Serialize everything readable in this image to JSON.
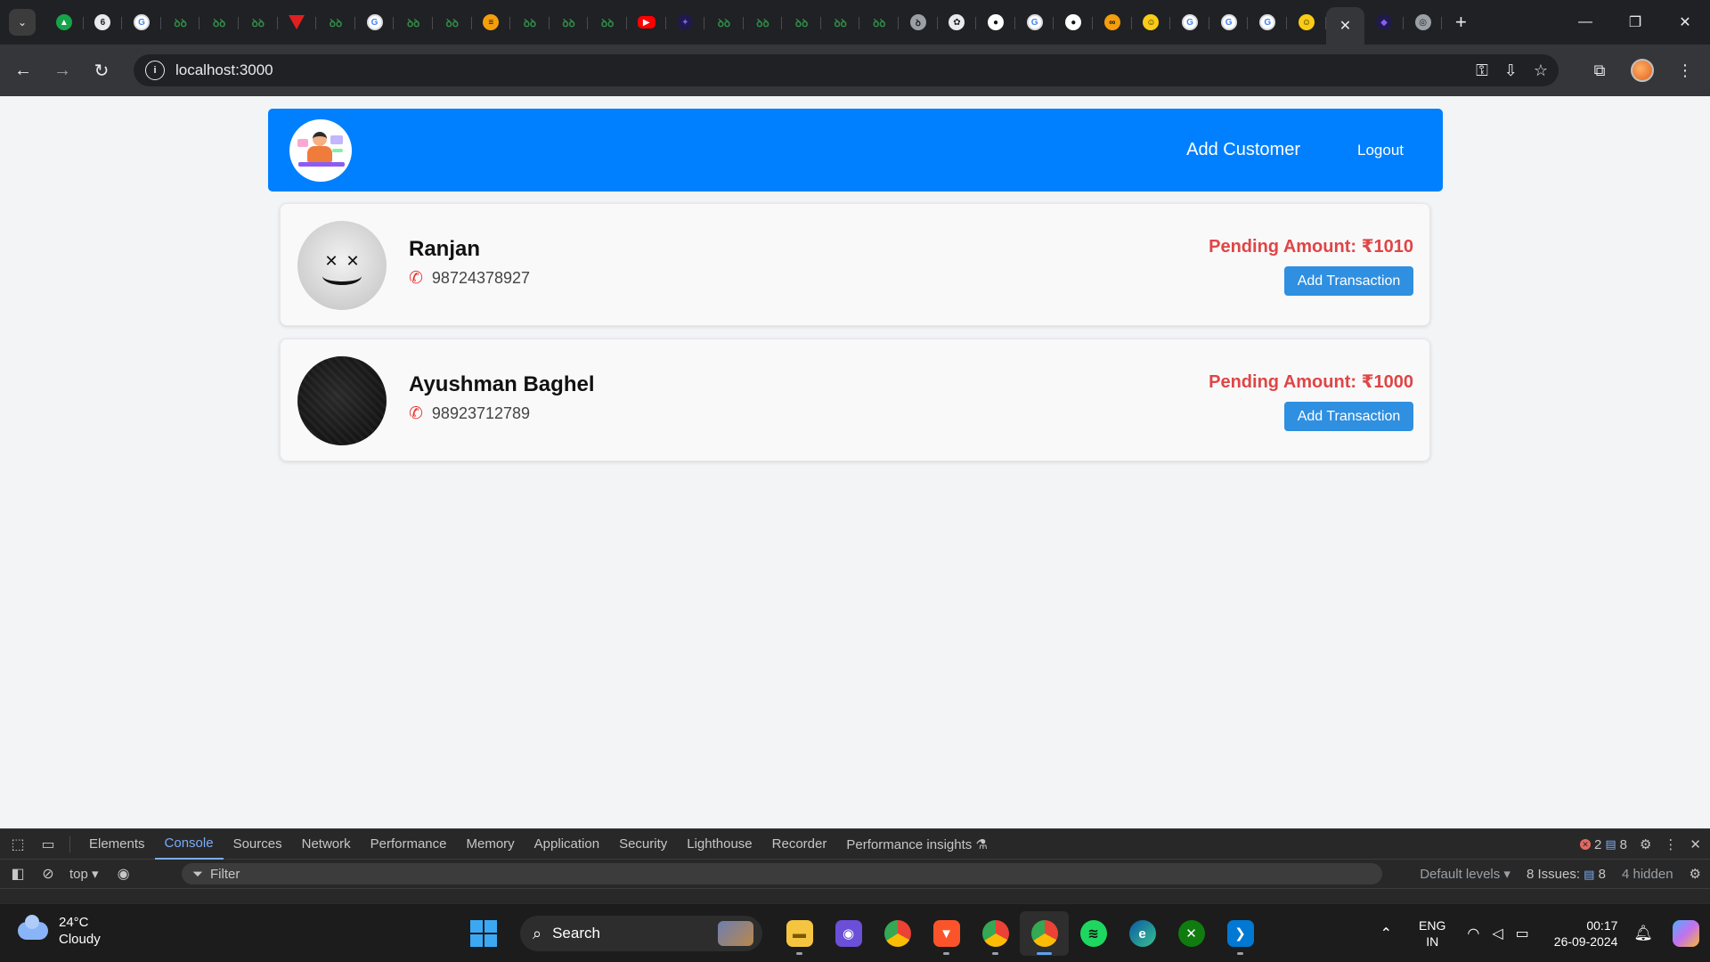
{
  "browser": {
    "tab_favicons": [
      "gfg-icon-green-circle",
      "chromatic-icon",
      "google-icon",
      "gfg-icon",
      "gfg-icon",
      "gfg-icon",
      "vercel-icon",
      "gfg-icon",
      "google-icon",
      "gfg-icon",
      "gfg-icon",
      "sort-icon",
      "gfg-icon",
      "gfg-icon",
      "gfg-icon",
      "youtube-icon",
      "dark-app-icon",
      "gfg-icon",
      "gfg-icon",
      "gfg-icon",
      "gfg-icon",
      "gfg-icon",
      "gfg-icon",
      "openai-icon",
      "github-icon",
      "google-icon",
      "github-icon",
      "infinity-icon",
      "yellow-app-icon",
      "google-icon",
      "google-icon",
      "google-icon",
      "yellow-app-icon"
    ],
    "active_tab_close": "✕",
    "url": "localhost:3000"
  },
  "app": {
    "nav": {
      "add_customer": "Add Customer",
      "logout": "Logout"
    },
    "customers": [
      {
        "name": "Ranjan",
        "phone": "98724378927",
        "pending": "Pending Amount: ₹1010",
        "action": "Add Transaction",
        "avatar": "marshmello-avatar"
      },
      {
        "name": "Ayushman Baghel",
        "phone": "98923712789",
        "pending": "Pending Amount: ₹1000",
        "action": "Add Transaction",
        "avatar": "dark-avatar"
      }
    ],
    "colors": {
      "navbar": "#0080ff",
      "pending": "#e04545",
      "button": "#2f8fe0"
    }
  },
  "devtools": {
    "tabs": [
      "Elements",
      "Console",
      "Sources",
      "Network",
      "Performance",
      "Memory",
      "Application",
      "Security",
      "Lighthouse",
      "Recorder",
      "Performance insights ⚗"
    ],
    "active_tab": "Console",
    "errors": "2",
    "messages": "8",
    "context": "top ▾",
    "filter_placeholder": "Filter",
    "levels": "Default levels ▾",
    "issues_label": "8 Issues:",
    "issues_count": "8",
    "hidden": "4 hidden"
  },
  "taskbar": {
    "weather_temp": "24°C",
    "weather_desc": "Cloudy",
    "search": "Search",
    "lang_top": "ENG",
    "lang_bottom": "IN",
    "time": "00:17",
    "date": "26-09-2024"
  }
}
